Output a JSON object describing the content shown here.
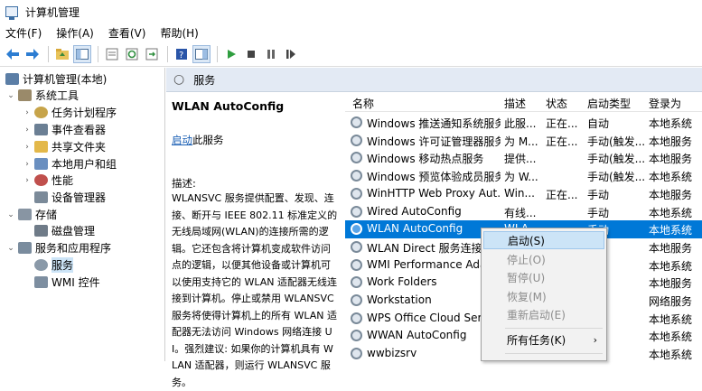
{
  "window": {
    "title": "计算机管理"
  },
  "menu": [
    "文件(F)",
    "操作(A)",
    "查看(V)",
    "帮助(H)"
  ],
  "toolbar_icons": [
    "back-icon",
    "forward-icon",
    "up-folder-icon",
    "show-tree-icon",
    "properties-icon",
    "refresh-icon",
    "export-icon",
    "help-icon",
    "console-icon",
    "play-icon",
    "stop-icon",
    "pause-icon",
    "restart-icon"
  ],
  "tree": [
    {
      "label": "计算机管理(本地)",
      "icon": "computer-icon",
      "arrow": "",
      "color": "#5b7ea6"
    },
    {
      "label": "系统工具",
      "icon": "tools-icon",
      "arrow": "⌄",
      "color": "#9a8a6a"
    },
    {
      "label": "任务计划程序",
      "icon": "clock-icon",
      "arrow": "›",
      "color": "#c7a44a"
    },
    {
      "label": "事件查看器",
      "icon": "event-viewer-icon",
      "arrow": "›",
      "color": "#6b7f94"
    },
    {
      "label": "共享文件夹",
      "icon": "shared-folder-icon",
      "arrow": "›",
      "color": "#e3b84a"
    },
    {
      "label": "本地用户和组",
      "icon": "users-icon",
      "arrow": "›",
      "color": "#6a8fc0"
    },
    {
      "label": "性能",
      "icon": "performance-icon",
      "arrow": "›",
      "color": "#c0504d"
    },
    {
      "label": "设备管理器",
      "icon": "device-manager-icon",
      "arrow": "",
      "color": "#7b8a99"
    },
    {
      "label": "存储",
      "icon": "storage-icon",
      "arrow": "⌄",
      "color": "#8895a3"
    },
    {
      "label": "磁盘管理",
      "icon": "disk-icon",
      "arrow": "",
      "color": "#6f7b88"
    },
    {
      "label": "服务和应用程序",
      "icon": "services-apps-icon",
      "arrow": "⌄",
      "color": "#7a8c9e"
    },
    {
      "label": "服务",
      "icon": "gear-icon",
      "arrow": "",
      "color": "#8a99a8"
    },
    {
      "label": "WMI 控件",
      "icon": "wmi-icon",
      "arrow": "",
      "color": "#7d8ea0"
    }
  ],
  "panel_title": "服务",
  "detail": {
    "name": "WLAN AutoConfig",
    "start_link": "启动",
    "start_suffix": "此服务",
    "desc_label": "描述:",
    "desc_text": "WLANSVC 服务提供配置、发现、连接、断开与 IEEE 802.11 标准定义的无线局域网(WLAN)的连接所需的逻辑。它还包含将计算机变成软件访问点的逻辑，以便其他设备或计算机可以使用支持它的 WLAN 适配器无线连接到计算机。停止或禁用 WLANSVC 服务将使得计算机上的所有 WLAN 适配器无法访问 Windows 网络连接 UI。强烈建议: 如果你的计算机具有 WLAN 适配器，则运行 WLANSVC 服务。"
  },
  "columns": {
    "name": "名称",
    "desc": "描述",
    "status": "状态",
    "startup": "启动类型",
    "logon": "登录为"
  },
  "rows": [
    {
      "name": "Windows 推送通知系统服务",
      "desc": "此服...",
      "status": "正在...",
      "startup": "自动",
      "logon": "本地系统"
    },
    {
      "name": "Windows 许可证管理器服务",
      "desc": "为 M...",
      "status": "正在...",
      "startup": "手动(触发...",
      "logon": "本地服务"
    },
    {
      "name": "Windows 移动热点服务",
      "desc": "提供...",
      "status": "",
      "startup": "手动(触发...",
      "logon": "本地服务"
    },
    {
      "name": "Windows 预览体验成员服务",
      "desc": "为 W...",
      "status": "",
      "startup": "手动(触发...",
      "logon": "本地系统"
    },
    {
      "name": "WinHTTP Web Proxy Aut...",
      "desc": "Win...",
      "status": "正在...",
      "startup": "手动",
      "logon": "本地服务"
    },
    {
      "name": "Wired AutoConfig",
      "desc": "有线...",
      "status": "",
      "startup": "手动",
      "logon": "本地系统"
    },
    {
      "name": "WLAN AutoConfig",
      "desc": "WLA...",
      "status": "",
      "startup": "手动",
      "logon": "本地系统"
    },
    {
      "name": "WLAN Direct 服务连接管...",
      "desc": "",
      "status": "",
      "startup": "",
      "logon": "本地服务"
    },
    {
      "name": "WMI Performance Ada...",
      "desc": "",
      "status": "",
      "startup": "",
      "logon": "本地系统"
    },
    {
      "name": "Work Folders",
      "desc": "",
      "status": "",
      "startup": "",
      "logon": "本地服务"
    },
    {
      "name": "Workstation",
      "desc": "",
      "status": "",
      "startup": "",
      "logon": "网络服务"
    },
    {
      "name": "WPS Office Cloud Serv...",
      "desc": "",
      "status": "",
      "startup": "",
      "logon": "本地系统"
    },
    {
      "name": "WWAN AutoConfig",
      "desc": "",
      "status": "",
      "startup": "",
      "logon": "本地系统"
    },
    {
      "name": "wwbizsrv",
      "desc": "",
      "status": "",
      "startup": "",
      "logon": "本地系统"
    }
  ],
  "context_menu": [
    {
      "label": "启动(S)",
      "state": "highlighted"
    },
    {
      "label": "停止(O)",
      "state": "disabled"
    },
    {
      "label": "暂停(U)",
      "state": "disabled"
    },
    {
      "label": "恢复(M)",
      "state": "disabled"
    },
    {
      "label": "重新启动(E)",
      "state": "disabled"
    },
    {
      "label": "所有任务(K)",
      "state": "submenu",
      "arrow": "›"
    }
  ],
  "colors": {
    "selection": "#0078d7",
    "header_band": "#e3eaf4",
    "menu_highlight": "#cce4f7"
  }
}
